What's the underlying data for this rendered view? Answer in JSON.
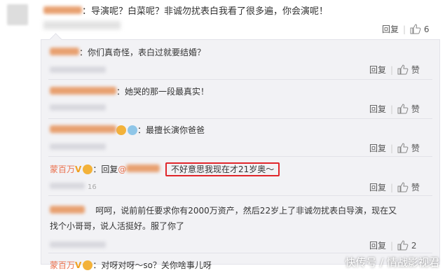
{
  "main_comment": {
    "text": "：导演呢？白菜呢？非诚勿扰表白我看了很多遍，你会演呢！",
    "reply_label": "回复",
    "like_count": "6"
  },
  "replies": [
    {
      "text": "：你们真奇怪，表白过就要结婚？",
      "reply_label": "回复",
      "like_label": "赞"
    },
    {
      "text": "：她哭的那一段最真实！",
      "reply_label": "回复",
      "like_label": "赞"
    },
    {
      "text": "：最擅长演你爸爸",
      "reply_label": "回复",
      "like_label": "赞"
    },
    {
      "name": "蒙百万",
      "middle": "：回复",
      "link": "@",
      "highlight": "不好意思我现在才21岁奥～",
      "time_partial": "16",
      "reply_label": "回复",
      "like_label": "赞"
    },
    {
      "text_line1": "呵呵，说前前任要求你有2000万资产，然后22岁上了非诚勿扰表白导演，现在又",
      "text_line2": "找个小哥哥，说人活挺好。服了你了",
      "reply_label": "回复",
      "like_count": "2"
    },
    {
      "name": "蒙百万",
      "text": "：对呀对呀～so？关你啥事儿呀"
    }
  ],
  "watermark": "快传号 / 情战影视君",
  "colors": {
    "link": "#eb7350",
    "highlight_border": "#e0262b",
    "box_bg": "#f2f2f5"
  }
}
